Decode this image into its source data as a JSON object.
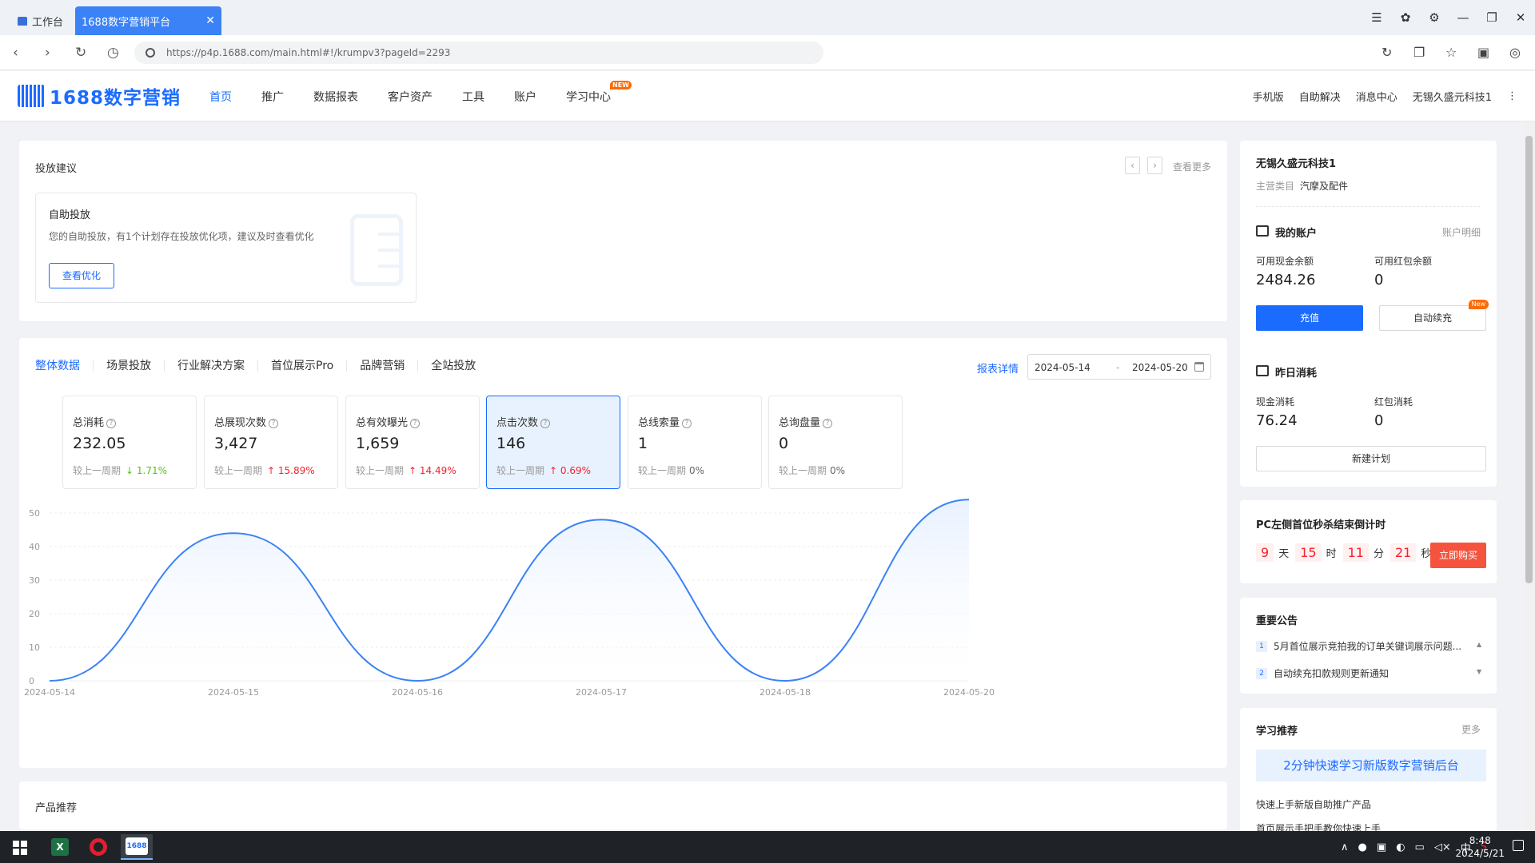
{
  "browser": {
    "tab_work": "工作台",
    "tab_active": "1688数字营销平台",
    "url": "https://p4p.1688.com/main.html#!/krumpv3?pageId=2293"
  },
  "header": {
    "logo": "1688数字营销",
    "nav": [
      "首页",
      "推广",
      "数据报表",
      "客户资产",
      "工具",
      "账户",
      "学习中心"
    ],
    "nav_badge": "NEW",
    "right": [
      "手机版",
      "自助解决",
      "消息中心",
      "无锡久盛元科技1"
    ]
  },
  "suggestion": {
    "title": "投放建议",
    "see_more": "查看更多",
    "box_title": "自助投放",
    "box_desc": "您的自助投放，有1个计划存在投放优化项，建议及时查看优化",
    "box_button": "查看优化"
  },
  "data_panel": {
    "tabs": [
      "整体数据",
      "场景投放",
      "行业解决方案",
      "首位展示Pro",
      "品牌营销",
      "全站投放"
    ],
    "report_link": "报表详情",
    "date_start": "2024-05-14",
    "date_sep": "-",
    "date_end": "2024-05-20",
    "compare_label": "较上一周期",
    "metrics": [
      {
        "label": "总消耗",
        "value": "232.05",
        "change": "↓ 1.71%",
        "trend": "down"
      },
      {
        "label": "总展现次数",
        "value": "3,427",
        "change": "↑ 15.89%",
        "trend": "up"
      },
      {
        "label": "总有效曝光",
        "value": "1,659",
        "change": "↑ 14.49%",
        "trend": "up"
      },
      {
        "label": "点击次数",
        "value": "146",
        "change": "↑ 0.69%",
        "trend": "up",
        "selected": true
      },
      {
        "label": "总线索量",
        "value": "1",
        "change": "0%",
        "trend": "flat"
      },
      {
        "label": "总询盘量",
        "value": "0",
        "change": "0%",
        "trend": "flat"
      }
    ]
  },
  "chart_data": {
    "type": "area",
    "x": [
      "2024-05-14",
      "2024-05-15",
      "2024-05-16",
      "2024-05-17",
      "2024-05-18",
      "2024-05-20"
    ],
    "x_ticks": [
      "2024-05-14",
      "2024-05-15",
      "2024-05-16",
      "2024-05-17",
      "2024-05-18",
      "2024-05-20"
    ],
    "y_ticks": [
      0,
      10,
      20,
      30,
      40,
      50
    ],
    "ylim": [
      0,
      55
    ],
    "series": [
      {
        "values": [
          0,
          44,
          0,
          48,
          0,
          54
        ]
      }
    ],
    "grid": true,
    "colors": {
      "line": "#3b82f6",
      "fill": "#e6f0ff"
    }
  },
  "product": {
    "title": "产品推荐"
  },
  "sidebar": {
    "company": "无锡久盛元科技1",
    "category_label": "主营类目",
    "category_value": "汽摩及配件",
    "account_title": "我的账户",
    "account_detail": "账户明细",
    "cash_label": "可用现金余额",
    "cash_value": "2484.26",
    "redpack_label": "可用红包余额",
    "redpack_value": "0",
    "recharge": "充值",
    "auto_recharge": "自动续充",
    "auto_badge": "New",
    "yesterday_title": "昨日消耗",
    "cash_spend_label": "现金消耗",
    "cash_spend_value": "76.24",
    "red_spend_label": "红包消耗",
    "red_spend_value": "0",
    "new_plan": "新建计划",
    "countdown_title": "PC左侧首位秒杀结束倒计时",
    "cd_days": "9",
    "cd_days_u": "天",
    "cd_hours": "15",
    "cd_hours_u": "时",
    "cd_mins": "11",
    "cd_mins_u": "分",
    "cd_secs": "21",
    "cd_secs_u": "秒",
    "buy_now": "立即购买",
    "notice_title": "重要公告",
    "notices": [
      "5月首位展示竞拍我的订单关键词展示问题...",
      "自动续充扣款规则更新通知"
    ],
    "learn_title": "学习推荐",
    "learn_more": "更多",
    "learn_banner": "2分钟快速学习新版数字营销后台",
    "learn_item1": "快速上手新版自助推广产品",
    "learn_item2": "首页展示手把手教你快速上手"
  },
  "taskbar": {
    "time": "8:48",
    "date": "2024/5/21",
    "ime": "中"
  }
}
